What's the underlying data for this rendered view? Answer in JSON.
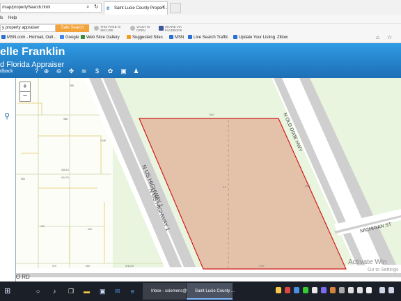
{
  "browser": {
    "address": "/map/propertySearch.html",
    "tab_title": "Saint Lucie County Propert...",
    "tab_close": "×",
    "menu": [
      "ls",
      "Help"
    ]
  },
  "toolbar": {
    "search_value": "y property appraiser",
    "search_button": "Safe Search",
    "security": [
      {
        "line1": "THIS PAGE IS",
        "line2": "SECURE"
      },
      {
        "line1": "VAULT IS",
        "line2": "OPEN"
      },
      {
        "line1": "SHARE VIA",
        "line2": "FACEBOOK"
      }
    ]
  },
  "favorites": [
    {
      "label": "MSN.com - Hotmail, Outl...",
      "color": "#2a6fd1"
    },
    {
      "label": "Google",
      "color": "#4285f4"
    },
    {
      "label": "Web Slice Gallery",
      "color": "#3a8e3a"
    },
    {
      "label": "Suggested Sites",
      "color": "#f29d1e"
    },
    {
      "label": "MSN",
      "color": "#2a6fd1"
    },
    {
      "label": "Live Search Traffic",
      "color": "#2a6fd1"
    },
    {
      "label": "Update Your Listing",
      "color": "#2a6fd1"
    },
    {
      "label": "Zillow",
      "color": "#2a6fd1"
    }
  ],
  "site": {
    "title": "elle Franklin",
    "subtitle": "d Florida Appraiser",
    "feedback": "dback"
  },
  "map": {
    "zoom_in": "+",
    "zoom_out": "−",
    "roads": {
      "us1_a": "N US HIGHWAY 1",
      "us1_b": "N US HIGHWAY 1",
      "dixie": "N OLD DIXIE HWY",
      "michigan": "MICHIGAN ST",
      "indrio": "INDRIO RD"
    },
    "parcel_labels": {
      "top": "7007",
      "bottom": "7707",
      "right": "1007",
      "mid": "0.0"
    },
    "small_labels": [
      "988",
      "436.16",
      "404.76",
      "550",
      "370",
      "300",
      "370.767",
      "1248",
      "988",
      "220",
      "400"
    ],
    "parcel_fill": "#e4c2a9",
    "parcel_stroke": "#d01a1a"
  },
  "watermark": {
    "line1": "Activate Win",
    "line2": "Go to Settings"
  },
  "taskbar": {
    "items": [
      {
        "label": "Inbox - ssiemens@...",
        "active": false
      },
      {
        "label": "Saint Lucie County ...",
        "active": true
      }
    ]
  }
}
